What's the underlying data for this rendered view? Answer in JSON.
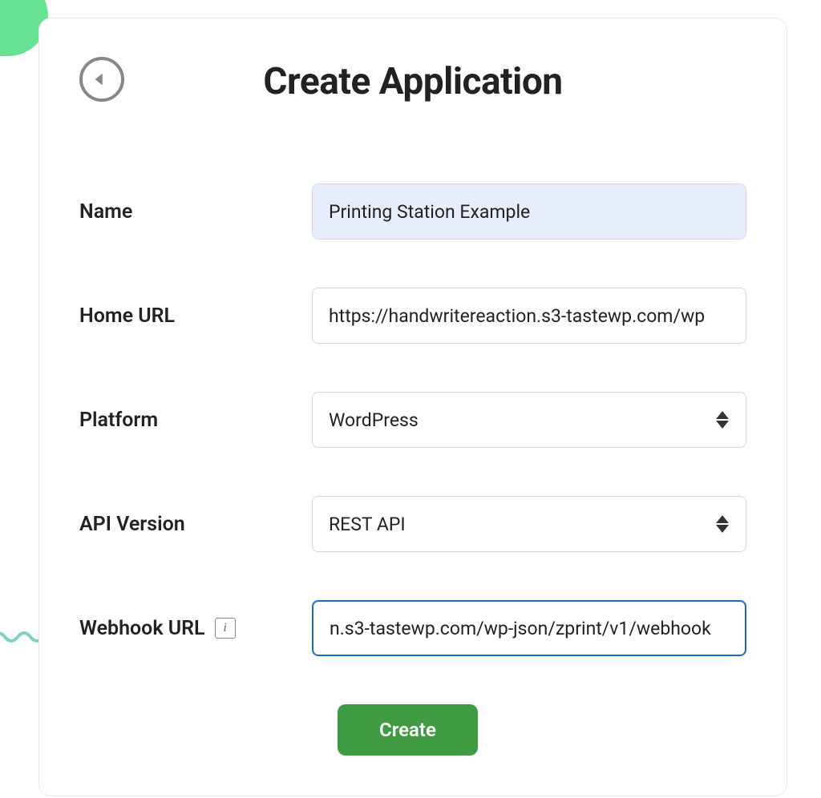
{
  "header": {
    "title": "Create Application"
  },
  "form": {
    "name": {
      "label": "Name",
      "value": "Printing Station Example"
    },
    "home_url": {
      "label": "Home URL",
      "value": "https://handwritereaction.s3-tastewp.com/wp"
    },
    "platform": {
      "label": "Platform",
      "value": "WordPress"
    },
    "api_version": {
      "label": "API Version",
      "value": "REST API"
    },
    "webhook_url": {
      "label": "Webhook URL",
      "value": "n.s3-tastewp.com/wp-json/zprint/v1/webhook"
    }
  },
  "buttons": {
    "create": "Create"
  }
}
